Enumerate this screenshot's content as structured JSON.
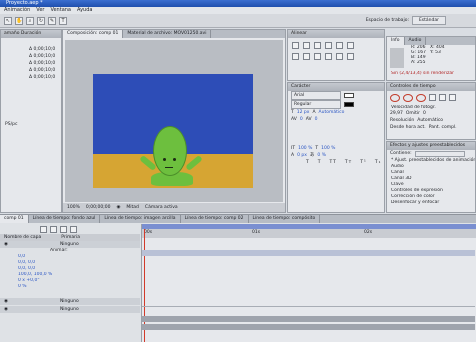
{
  "window": {
    "title": "Proyecto.aep *"
  },
  "menu": [
    "Animación",
    "Ver",
    "Ventana",
    "Ayuda"
  ],
  "project_panel": {
    "column_header": "amaño  Duración",
    "rows": [
      "Δ 0;00;10;0",
      "Δ 0;00;10;0",
      "Δ 0;00;10;0",
      "Δ 0;00;10;0",
      "Δ 0;00;10;0"
    ],
    "footer": "PS/pc"
  },
  "composition_panel": {
    "tabs": [
      "Composición: comp 01",
      "Material de archivo: MOV01250.avi"
    ],
    "footer": {
      "zoom": "100%",
      "timecode": "0;00;00;00",
      "quality": "Mitad",
      "camera": "Cámara activa"
    }
  },
  "scene": {
    "colors": {
      "sky": "#2d4db7",
      "sand": "#d6a533",
      "character": "#6dbf3e"
    }
  },
  "workspace": {
    "label": "Espacio de trabajo:",
    "value": "Estándar"
  },
  "align_panel": {
    "title": "Alinear"
  },
  "info_panel": {
    "tabs": [
      "Info",
      "Audio"
    ],
    "lines": [
      "R: 206",
      "G: 167",
      "B: 149",
      "A: 255"
    ],
    "coords": [
      "X: 404",
      "Y: 53"
    ],
    "status": "Sin (2,4/13,4) sin renderizar"
  },
  "character_panel": {
    "title": "Carácter",
    "font": "Arial",
    "style": "Regular",
    "values": [
      "12 px",
      "Automático",
      "0",
      "0",
      "100 %",
      "100 %",
      "0 px",
      "0 %"
    ]
  },
  "time_controls": {
    "title": "Controles de tiempo",
    "fps_label": "Velocidad de fotogr.",
    "fps_value": "29,97",
    "skip_label": "Omitir",
    "skip_value": "0",
    "resolution_label": "Resolución",
    "resolution_value": "Automático",
    "from_label": "Desde hora act.",
    "full_label": "Pant. compl."
  },
  "effects_panel": {
    "title": "Efectos y ajustes preestablecidos",
    "search_label": "Contiene:",
    "items": [
      "* Ajust. preestablecidos de animación",
      "Audio",
      "Canal",
      "Canal 3D",
      "Clave",
      "Controles de expresión",
      "Corrección de color",
      "Desenfocar y enfocar"
    ]
  },
  "timeline": {
    "tabs": [
      "comp 01",
      "Línea de tiempo: fondo azul",
      "Línea de tiempo: imagen arcilla",
      "Línea de tiempo: comp 02",
      "Línea de tiempo: compósito"
    ],
    "column_header": "Nombre de capa",
    "layer_header": "Primaria",
    "values": [
      "Animar:",
      "0,0",
      "0,0, 0,0",
      "0,0, 0,0",
      "100,0, 100,0 %",
      "0 x +0,0°",
      "0 %"
    ],
    "layer_mode": "Ninguno",
    "ruler": [
      "00s",
      "01s",
      "02s"
    ]
  }
}
